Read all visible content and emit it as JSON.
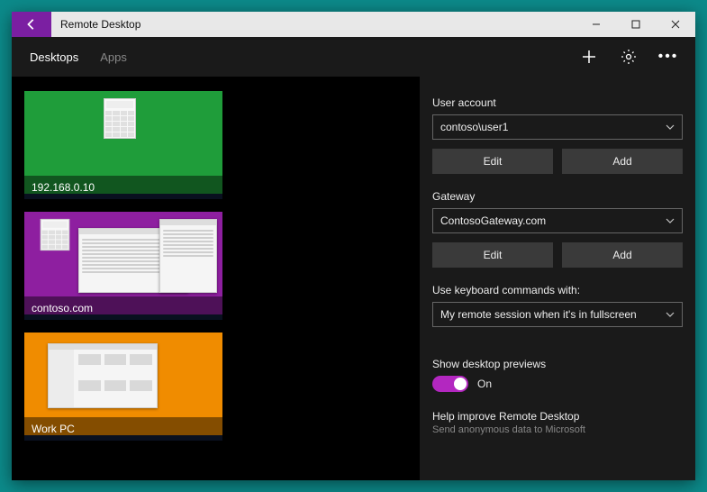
{
  "app_title": "Remote Desktop",
  "tabs": {
    "desktops": "Desktops",
    "apps": "Apps"
  },
  "desktops": [
    {
      "name": "192.168.0.10",
      "bg": "#1f9d3a"
    },
    {
      "name": "contoso.com",
      "bg": "#8e1fa0"
    },
    {
      "name": "Work PC",
      "bg": "#f08c00"
    }
  ],
  "pane": {
    "user_account": {
      "label": "User account",
      "selected": "contoso\\user1",
      "edit": "Edit",
      "add": "Add"
    },
    "gateway": {
      "label": "Gateway",
      "selected": "ContosoGateway.com",
      "edit": "Edit",
      "add": "Add"
    },
    "keyboard": {
      "label": "Use keyboard commands with:",
      "selected": "My remote session when it's in fullscreen"
    },
    "previews": {
      "label": "Show desktop previews",
      "state_text": "On"
    },
    "help": {
      "title": "Help improve Remote Desktop",
      "subtitle": "Send anonymous data to Microsoft"
    }
  }
}
